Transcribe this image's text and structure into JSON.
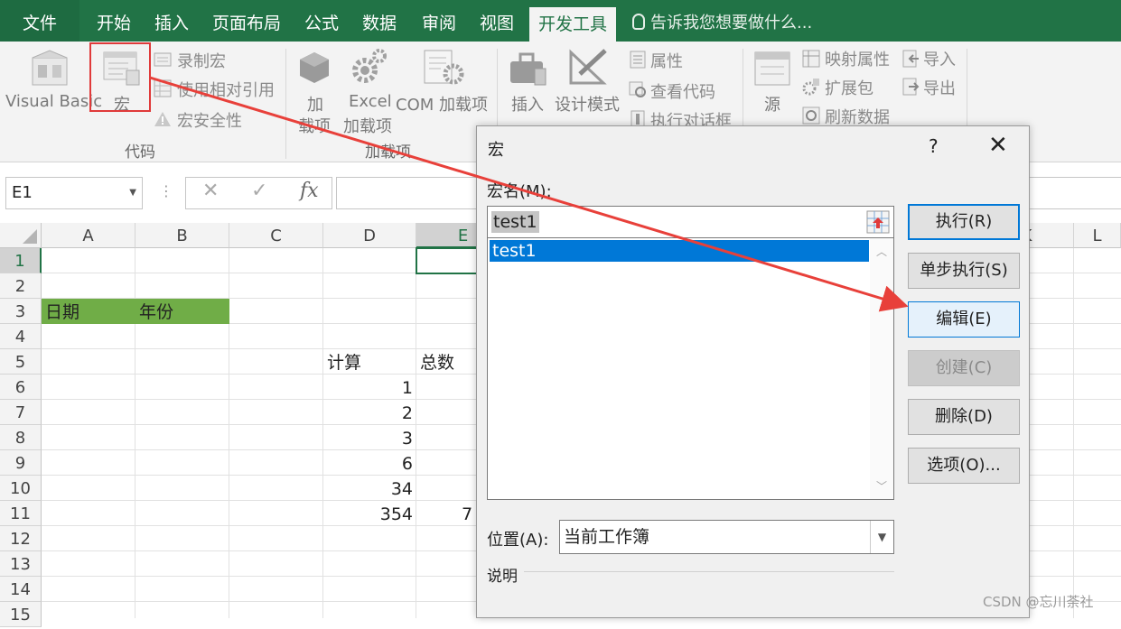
{
  "ribbon_tabs": [
    "文件",
    "开始",
    "插入",
    "页面布局",
    "公式",
    "数据",
    "审阅",
    "视图",
    "开发工具"
  ],
  "tell_me": "告诉我您想要做什么...",
  "ribbon": {
    "code": {
      "visual_basic": "Visual Basic",
      "macros": "宏",
      "record_macro": "录制宏",
      "relative_refs": "使用相对引用",
      "macro_security": "宏安全性",
      "group_label": "代码"
    },
    "addins": {
      "addins_line1": "加",
      "addins_line2": "载项",
      "excel_addins_line1": "Excel",
      "excel_addins_line2": "加载项",
      "com_addins": "COM 加载项",
      "group_label": "加载项"
    },
    "controls": {
      "insert": "插入",
      "design_mode": "设计模式",
      "properties": "属性",
      "view_code": "查看代码",
      "run_dialog": "执行对话框"
    },
    "xml": {
      "source": "源",
      "map_properties": "映射属性",
      "expansion_packs": "扩展包",
      "refresh_data": "刷新数据",
      "import": "导入",
      "export": "导出"
    }
  },
  "formula_bar": {
    "name_box": "E1",
    "cancel_glyph": "✕",
    "enter_glyph": "✓",
    "fx_glyph": "fx"
  },
  "sheet": {
    "columns": [
      "A",
      "B",
      "C",
      "D",
      "E",
      "",
      "",
      "",
      "",
      "",
      "K",
      "L"
    ],
    "rows": [
      "1",
      "2",
      "3",
      "4",
      "5",
      "6",
      "7",
      "8",
      "9",
      "10",
      "11",
      "12",
      "13",
      "14",
      "15"
    ],
    "a3": "日期",
    "b3": "年份",
    "d5": "计算",
    "e5": "总数",
    "d_values": [
      "1",
      "2",
      "3",
      "6",
      "34",
      "354"
    ],
    "e11": "7"
  },
  "dialog": {
    "title": "宏",
    "help": "?",
    "close": "✕",
    "macro_name_label": "宏名(M):",
    "macro_name_value": "test1",
    "macro_list": [
      "test1"
    ],
    "buttons": {
      "run": "执行(R)",
      "step_into": "单步执行(S)",
      "edit": "编辑(E)",
      "create": "创建(C)",
      "delete": "删除(D)",
      "options": "选项(O)..."
    },
    "location_label": "位置(A):",
    "location_value": "当前工作簿",
    "description_label": "说明"
  },
  "watermark": "CSDN @忘川荼社",
  "colors": {
    "ribbon_green": "#217346",
    "header_fill": "#70ad47",
    "selection_blue": "#0078d7",
    "annotation_red": "#e03a3a"
  }
}
